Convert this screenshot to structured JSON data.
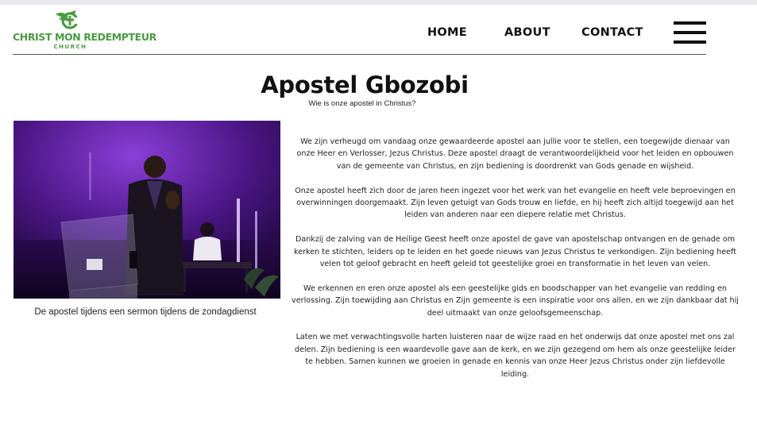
{
  "site": {
    "logo_main": "CHRIST MON REDEMPTEUR",
    "logo_sub": "CHURCH",
    "brand_color": "#4a9a43"
  },
  "nav": {
    "items": [
      {
        "label": "HOME"
      },
      {
        "label": "ABOUT"
      },
      {
        "label": "CONTACT"
      }
    ],
    "menu_icon": "hamburger-menu-icon"
  },
  "page": {
    "title": "Apostel Gbozobi",
    "subtitle": "Wie is onze apostel in Christus?"
  },
  "photo": {
    "caption": "De apostel tijdens een sermon tijdens de zondagdienst"
  },
  "article": {
    "paragraphs": [
      "We zijn verheugd om vandaag onze gewaardeerde apostel aan jullie voor te stellen, een toegewijde dienaar van onze Heer en Verlosser, Jezus Christus. Deze apostel draagt de verantwoordelijkheid voor het leiden en opbouwen van de gemeente van Christus, en zijn bediening is doordrenkt van Gods genade en wijsheid.",
      "Onze apostel heeft zich door de jaren heen ingezet voor het werk van het evangelie en heeft vele beproevingen en overwinningen doorgemaakt. Zijn leven getuigt van Gods trouw en liefde, en hij heeft zich altijd toegewijd aan het leiden van anderen naar een diepere relatie met Christus.",
      "Dankzij de zalving van de Heilige Geest heeft onze apostel de gave van apostelschap ontvangen en de genade om kerken te stichten, leiders op te leiden en het goede nieuws van Jezus Christus te verkondigen. Zijn bediening heeft velen tot geloof gebracht en heeft geleid tot geestelijke groei en transformatie in het leven van velen.",
      "We erkennen en eren onze apostel als een geestelijke gids en boodschapper van het evangelie van redding en verlossing. Zijn toewijding aan Christus en Zijn gemeente is een inspiratie voor ons allen, en we zijn dankbaar dat hij deel uitmaakt van onze geloofsgemeenschap.",
      "Laten we met verwachtingsvolle harten luisteren naar de wijze raad en het onderwijs dat onze apostel met ons zal delen. Zijn bediening is een waardevolle gave aan de kerk, en we zijn gezegend om hem als onze geestelijke leider te hebben. Samen kunnen we groeien in genade en kennis van onze Heer Jezus Christus onder zijn liefdevolle leiding."
    ]
  }
}
